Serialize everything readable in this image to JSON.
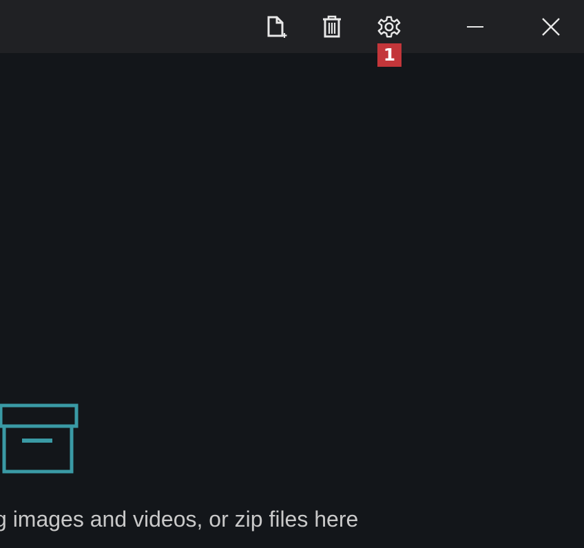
{
  "titlebar": {
    "buttons": [
      {
        "name": "new-file",
        "icon": "new-file-icon"
      },
      {
        "name": "delete",
        "icon": "trash-icon"
      },
      {
        "name": "settings",
        "icon": "gear-icon"
      },
      {
        "name": "minimize",
        "icon": "minimize-icon"
      },
      {
        "name": "close",
        "icon": "close-icon"
      }
    ],
    "badge": "1"
  },
  "dropzone": {
    "icon": "archive-box-icon",
    "text": "g images and videos, or zip files here"
  },
  "colors": {
    "titlebar_bg": "#202124",
    "body_bg": "#13161a",
    "accent": "#3a9aa5",
    "badge_bg": "#c3363a",
    "text": "#c9c9c9"
  }
}
